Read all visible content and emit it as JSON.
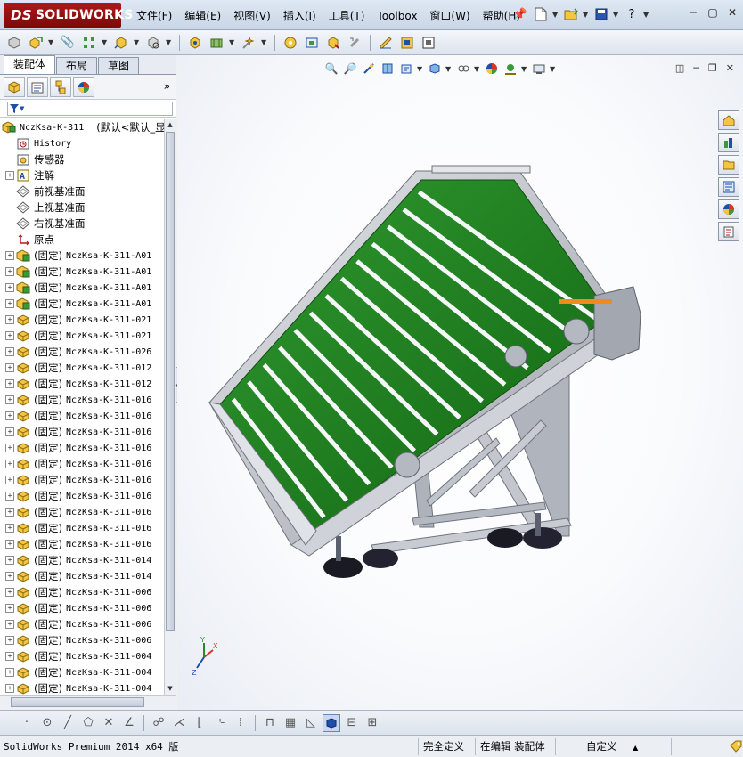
{
  "app": {
    "logo_ds": "DS",
    "logo_text": "SOLIDWORKS"
  },
  "menu": [
    {
      "label": "文件(F)"
    },
    {
      "label": "编辑(E)"
    },
    {
      "label": "视图(V)"
    },
    {
      "label": "插入(I)"
    },
    {
      "label": "工具(T)"
    },
    {
      "label": "Toolbox"
    },
    {
      "label": "窗口(W)"
    },
    {
      "label": "帮助(H)"
    }
  ],
  "panel": {
    "tabs": [
      {
        "label": "装配体",
        "active": true
      },
      {
        "label": "布局",
        "active": false
      },
      {
        "label": "草图",
        "active": false
      }
    ],
    "more_glyph": "»",
    "filter_glyph": "▼"
  },
  "tree": {
    "root": {
      "name": "NczKsa-K-311",
      "config": "(默认<默认_显"
    },
    "features": [
      {
        "label": "History",
        "icon": "history-icon",
        "mono": true
      },
      {
        "label": "传感器",
        "icon": "sensor-icon",
        "mono": false
      },
      {
        "label": "注解",
        "icon": "annotation-icon",
        "mono": false,
        "expandable": true
      },
      {
        "label": "前视基准面",
        "icon": "plane-icon",
        "mono": false
      },
      {
        "label": "上视基准面",
        "icon": "plane-icon",
        "mono": false
      },
      {
        "label": "右视基准面",
        "icon": "plane-icon",
        "mono": false
      },
      {
        "label": "原点",
        "icon": "origin-icon",
        "mono": false
      }
    ],
    "fixed_prefix": "(固定)",
    "components": [
      {
        "name": "NczKsa-K-311-A01",
        "type": "assembly"
      },
      {
        "name": "NczKsa-K-311-A01",
        "type": "assembly"
      },
      {
        "name": "NczKsa-K-311-A01",
        "type": "assembly"
      },
      {
        "name": "NczKsa-K-311-A01",
        "type": "assembly"
      },
      {
        "name": "NczKsa-K-311-021",
        "type": "part"
      },
      {
        "name": "NczKsa-K-311-021",
        "type": "part"
      },
      {
        "name": "NczKsa-K-311-026",
        "type": "part"
      },
      {
        "name": "NczKsa-K-311-012",
        "type": "part"
      },
      {
        "name": "NczKsa-K-311-012",
        "type": "part"
      },
      {
        "name": "NczKsa-K-311-016",
        "type": "part"
      },
      {
        "name": "NczKsa-K-311-016",
        "type": "part"
      },
      {
        "name": "NczKsa-K-311-016",
        "type": "part"
      },
      {
        "name": "NczKsa-K-311-016",
        "type": "part"
      },
      {
        "name": "NczKsa-K-311-016",
        "type": "part"
      },
      {
        "name": "NczKsa-K-311-016",
        "type": "part"
      },
      {
        "name": "NczKsa-K-311-016",
        "type": "part"
      },
      {
        "name": "NczKsa-K-311-016",
        "type": "part"
      },
      {
        "name": "NczKsa-K-311-016",
        "type": "part"
      },
      {
        "name": "NczKsa-K-311-016",
        "type": "part"
      },
      {
        "name": "NczKsa-K-311-014",
        "type": "part"
      },
      {
        "name": "NczKsa-K-311-014",
        "type": "part"
      },
      {
        "name": "NczKsa-K-311-006",
        "type": "part"
      },
      {
        "name": "NczKsa-K-311-006",
        "type": "part"
      },
      {
        "name": "NczKsa-K-311-006",
        "type": "part"
      },
      {
        "name": "NczKsa-K-311-006",
        "type": "part"
      },
      {
        "name": "NczKsa-K-311-004",
        "type": "part"
      },
      {
        "name": "NczKsa-K-311-004",
        "type": "part"
      },
      {
        "name": "NczKsa-K-311-004",
        "type": "part"
      }
    ]
  },
  "viewport": {
    "triad": {
      "x": "X",
      "y": "Y",
      "z": "Z"
    },
    "belt_color": "#1f7a1f",
    "frame_color": "#b9bcc4"
  },
  "status": {
    "product": "SolidWorks Premium 2014 x64 版",
    "definition": "完全定义",
    "mode": "在编辑 装配体",
    "units": "自定义",
    "units_caret": "▲"
  }
}
